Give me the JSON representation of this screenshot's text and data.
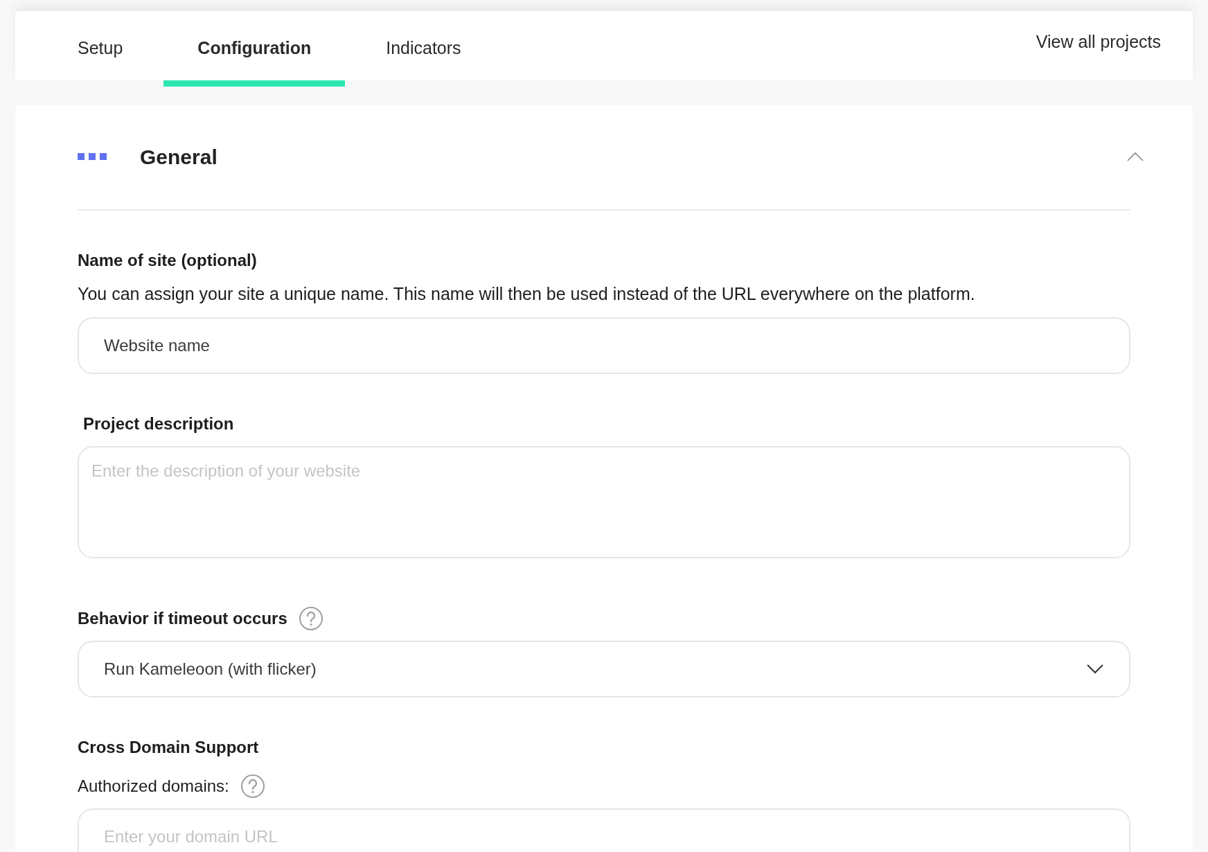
{
  "tabs": [
    {
      "label": "Setup",
      "selected": false
    },
    {
      "label": "Configuration",
      "selected": true
    },
    {
      "label": "Indicators",
      "selected": false
    }
  ],
  "view_all_link": "View all projects",
  "section": {
    "title": "General",
    "expanded": true,
    "fields": [
      {
        "kind": "input",
        "label": "Name of site (optional)",
        "label_bold": true,
        "description": "You can assign your site a unique name. This name will then be used instead of the URL everywhere on the platform.",
        "value": "Website name"
      },
      {
        "kind": "textarea",
        "label": "Project description",
        "label_bold": true,
        "placeholder": "Enter the description of your website"
      },
      {
        "kind": "select",
        "label": "Behavior if timeout occurs",
        "label_bold": true,
        "help": true,
        "value": "Run Kameleoon (with flicker)"
      },
      {
        "kind": "heading",
        "label": "Cross Domain Support",
        "label_bold": true
      },
      {
        "kind": "input",
        "label": "Authorized domains:",
        "label_bold": false,
        "help": true,
        "placeholder": "Enter your domain URL"
      }
    ]
  }
}
